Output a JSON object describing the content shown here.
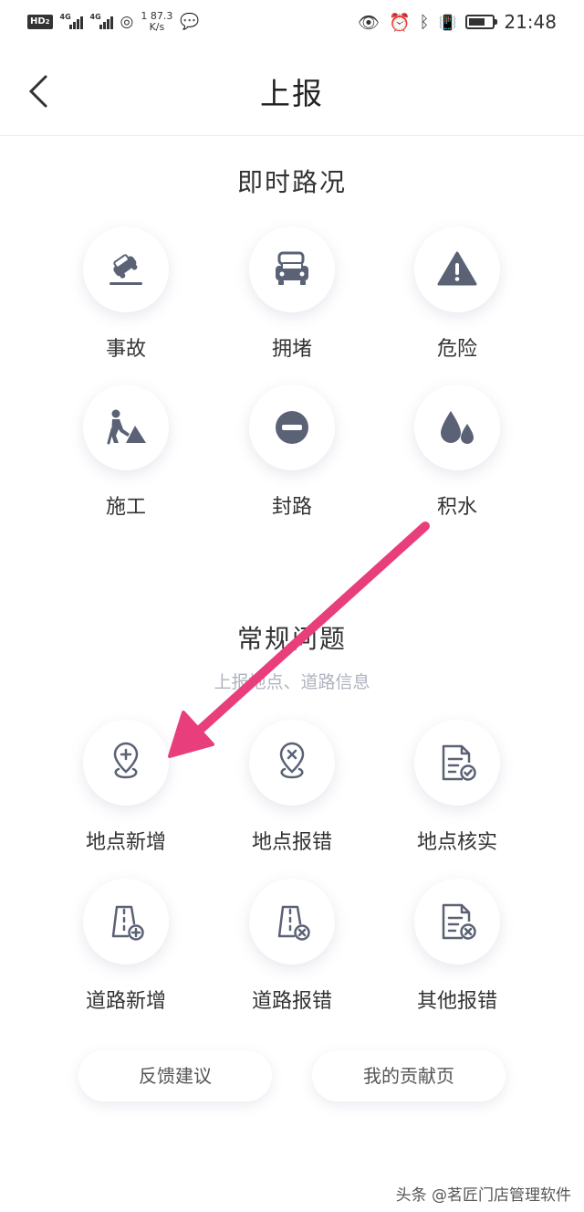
{
  "status_bar": {
    "network_badge": "HD",
    "network_badge_sub": "2",
    "signal1_gen": "4G",
    "signal2_gen": "4G",
    "speed_value": "87.3",
    "speed_unit": "K/s",
    "speed_prefix": "1",
    "time": "21:48"
  },
  "header": {
    "title": "上报"
  },
  "realtime": {
    "title": "即时路况",
    "items": [
      {
        "label": "事故",
        "icon": "car-accident-icon"
      },
      {
        "label": "拥堵",
        "icon": "traffic-jam-icon"
      },
      {
        "label": "危险",
        "icon": "warning-icon"
      },
      {
        "label": "施工",
        "icon": "construction-icon"
      },
      {
        "label": "封路",
        "icon": "road-closed-icon"
      },
      {
        "label": "积水",
        "icon": "water-drop-icon"
      }
    ]
  },
  "regular": {
    "title": "常规问题",
    "subtitle": "上报地点、道路信息",
    "items": [
      {
        "label": "地点新增",
        "icon": "location-add-icon"
      },
      {
        "label": "地点报错",
        "icon": "location-error-icon"
      },
      {
        "label": "地点核实",
        "icon": "document-check-icon"
      },
      {
        "label": "道路新增",
        "icon": "road-add-icon"
      },
      {
        "label": "道路报错",
        "icon": "road-error-icon"
      },
      {
        "label": "其他报错",
        "icon": "document-error-icon"
      }
    ]
  },
  "footer": {
    "feedback": "反馈建议",
    "contributions": "我的贡献页"
  },
  "watermark": "头条 @茗匠门店管理软件",
  "colors": {
    "icon": "#5b6275",
    "arrow": "#e83e7c",
    "divider": "#ececec"
  }
}
